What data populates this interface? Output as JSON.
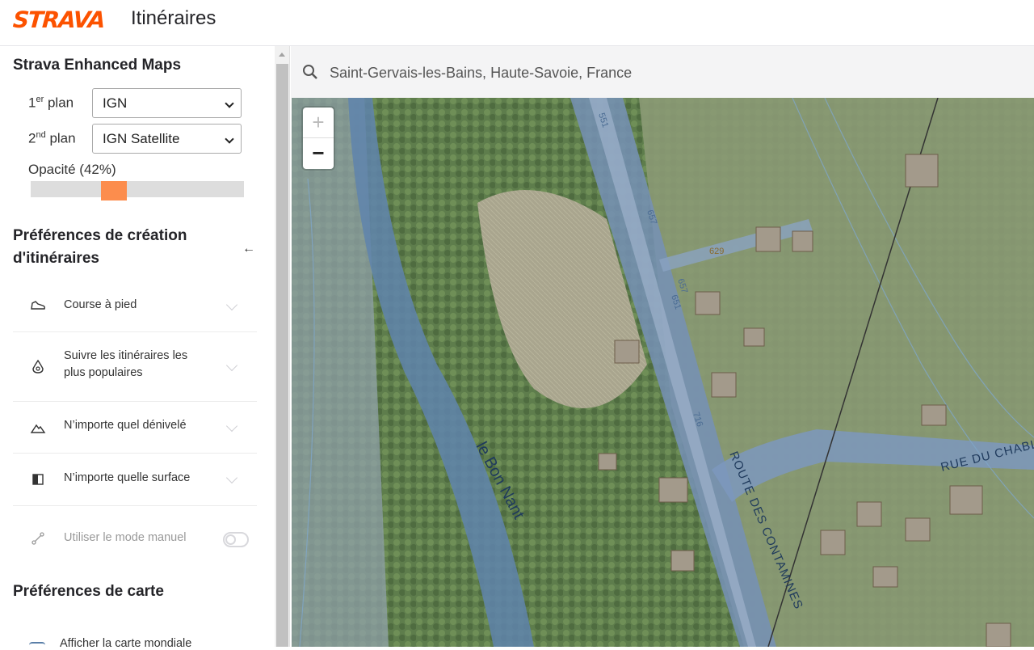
{
  "header": {
    "logo": "STRAVA",
    "title": "Itinéraires"
  },
  "enhanced_maps": {
    "title": "Strava Enhanced Maps",
    "layer1": {
      "label_main": "1",
      "label_sup": "er",
      "label_rest": " plan",
      "value": "IGN"
    },
    "layer2": {
      "label_main": "2",
      "label_sup": "nd",
      "label_rest": " plan",
      "value": "IGN Satellite"
    },
    "opacity": {
      "label": "Opacité (42%)",
      "value": 0.42
    }
  },
  "route_prefs": {
    "title_line1": "Préférences de création",
    "title_line2": "d'itinéraires",
    "items": [
      {
        "label": "Course à pied",
        "icon": "shoe-icon"
      },
      {
        "label_line1": "Suivre les itinéraires les",
        "label_line2": "plus populaires",
        "icon": "heatmap-icon"
      },
      {
        "label": "N’importe quel dénivelé",
        "icon": "elevation-icon"
      },
      {
        "label": "N’importe quelle surface",
        "icon": "surface-icon"
      },
      {
        "label": "Utiliser le mode manuel",
        "icon": "manual-route-icon",
        "toggle": false
      }
    ]
  },
  "map_prefs": {
    "title": "Préférences de carte",
    "item1": "Afficher la carte mondiale"
  },
  "search": {
    "query": "Saint-Gervais-les-Bains, Haute-Savoie, France"
  },
  "map": {
    "zoom_in": "+",
    "zoom_out": "−",
    "labels": {
      "river": "le Bon Nant",
      "road1": "ROUTE DES CONTAMINES",
      "road2": "RUE DU CHABL",
      "elev": [
        "551",
        "657",
        "657",
        "651",
        "716",
        "629"
      ]
    }
  },
  "colors": {
    "brand": "#fc5200",
    "slider": "#fc8d4d"
  }
}
